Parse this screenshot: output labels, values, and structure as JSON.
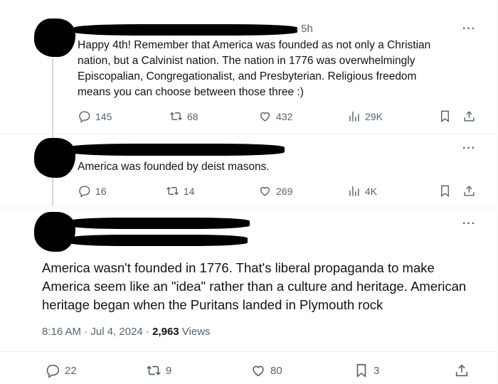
{
  "tweet1": {
    "time": "· 5h",
    "text": "Happy 4th! Remember that America was founded as not only a Christian\nnation, but a Calvinist nation. The nation in 1776 was overwhelmingly\nEpiscopalian, Congregationalist, and Presbyterian. Religious freedom\nmeans you can choose between those three :)",
    "more": "···",
    "replies": "145",
    "reposts": "68",
    "likes": "432",
    "views": "29K"
  },
  "tweet2": {
    "text": "America was founded by deist masons.",
    "more": "···",
    "replies": "16",
    "reposts": "14",
    "likes": "269",
    "views": "4K"
  },
  "tweet3": {
    "text": "America wasn't founded in 1776. That's liberal propaganda to make\nAmerica seem like an \"idea\" rather than a culture and heritage. American\nheritage began when the Puritans landed in Plymouth rock",
    "more": "···",
    "timestamp": "8:16 AM · Jul 4, 2024 · ",
    "views_count": "2,963",
    "views_label": " Views",
    "replies": "22",
    "reposts": "9",
    "likes": "80",
    "bookmarks": "3"
  },
  "icons": [
    "reply-icon",
    "repost-icon",
    "like-icon",
    "views-icon",
    "bookmark-icon",
    "share-icon"
  ],
  "colors": {
    "text": "#0f1419",
    "secondary": "#536471",
    "divider": "#eff3f4",
    "thread": "#cfd9de"
  }
}
